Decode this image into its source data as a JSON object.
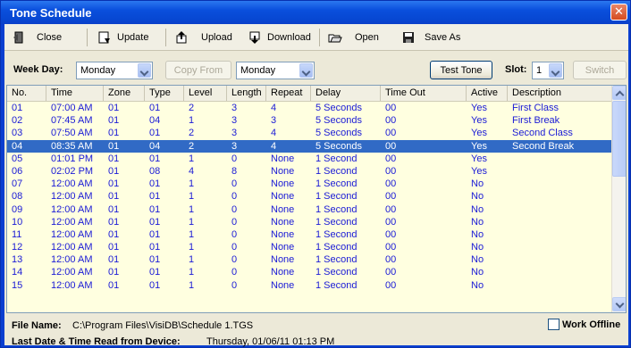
{
  "window": {
    "title": "Tone Schedule"
  },
  "toolbar": {
    "close": "Close",
    "update": "Update",
    "upload": "Upload",
    "download": "Download",
    "open": "Open",
    "save_as": "Save As"
  },
  "filters": {
    "week_day_label": "Week Day:",
    "week_day_value": "Monday",
    "copy_from": "Copy From",
    "copy_from_value": "Monday",
    "test_tone": "Test Tone",
    "slot_label": "Slot:",
    "slot_value": "1",
    "switch": "Switch"
  },
  "table": {
    "columns": [
      "No.",
      "Time",
      "Zone",
      "Type",
      "Level",
      "Length",
      "Repeat",
      "Delay",
      "Time Out",
      "Active",
      "Description"
    ],
    "selected_row": 3,
    "rows": [
      [
        "01",
        "07:00 AM",
        "01",
        "01",
        "2",
        "3",
        "4",
        "5 Seconds",
        "00",
        "Yes",
        "First Class"
      ],
      [
        "02",
        "07:45 AM",
        "01",
        "04",
        "1",
        "3",
        "3",
        "5 Seconds",
        "00",
        "Yes",
        "First Break"
      ],
      [
        "03",
        "07:50 AM",
        "01",
        "01",
        "2",
        "3",
        "4",
        "5 Seconds",
        "00",
        "Yes",
        "Second Class"
      ],
      [
        "04",
        "08:35 AM",
        "01",
        "04",
        "2",
        "3",
        "4",
        "5 Seconds",
        "00",
        "Yes",
        "Second Break"
      ],
      [
        "05",
        "01:01 PM",
        "01",
        "01",
        "1",
        "0",
        "None",
        "1 Second",
        "00",
        "Yes",
        ""
      ],
      [
        "06",
        "02:02 PM",
        "01",
        "08",
        "4",
        "8",
        "None",
        "1 Second",
        "00",
        "Yes",
        ""
      ],
      [
        "07",
        "12:00 AM",
        "01",
        "01",
        "1",
        "0",
        "None",
        "1 Second",
        "00",
        "No",
        ""
      ],
      [
        "08",
        "12:00 AM",
        "01",
        "01",
        "1",
        "0",
        "None",
        "1 Second",
        "00",
        "No",
        ""
      ],
      [
        "09",
        "12:00 AM",
        "01",
        "01",
        "1",
        "0",
        "None",
        "1 Second",
        "00",
        "No",
        ""
      ],
      [
        "10",
        "12:00 AM",
        "01",
        "01",
        "1",
        "0",
        "None",
        "1 Second",
        "00",
        "No",
        ""
      ],
      [
        "11",
        "12:00 AM",
        "01",
        "01",
        "1",
        "0",
        "None",
        "1 Second",
        "00",
        "No",
        ""
      ],
      [
        "12",
        "12:00 AM",
        "01",
        "01",
        "1",
        "0",
        "None",
        "1 Second",
        "00",
        "No",
        ""
      ],
      [
        "13",
        "12:00 AM",
        "01",
        "01",
        "1",
        "0",
        "None",
        "1 Second",
        "00",
        "No",
        ""
      ],
      [
        "14",
        "12:00 AM",
        "01",
        "01",
        "1",
        "0",
        "None",
        "1 Second",
        "00",
        "No",
        ""
      ],
      [
        "15",
        "12:00 AM",
        "01",
        "01",
        "1",
        "0",
        "None",
        "1 Second",
        "00",
        "No",
        ""
      ]
    ]
  },
  "status": {
    "file_name_label": "File Name:",
    "file_name": "C:\\Program Files\\VisiDB\\Schedule 1.TGS",
    "last_read_label": "Last Date & Time Read from Device:",
    "last_read": "Thursday, 01/06/11 01:13 PM",
    "work_offline": "Work Offline"
  },
  "colors": {
    "title_bar": "#0a4fdc",
    "grid_background": "#ffffe0",
    "cell_text": "#1a1ad6",
    "selection": "#316ac5"
  }
}
